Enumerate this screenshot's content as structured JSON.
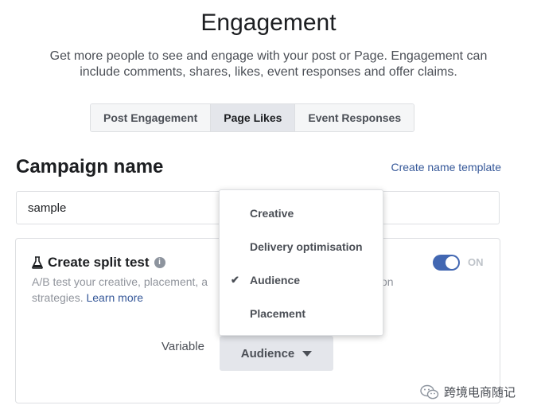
{
  "header": {
    "title": "Engagement",
    "subtitle_line1": "Get more people to see and engage with your post or Page. Engagement can",
    "subtitle_line2": "include comments, shares, likes, event responses and offer claims."
  },
  "tabs": [
    {
      "label": "Post Engagement",
      "active": false
    },
    {
      "label": "Page Likes",
      "active": true
    },
    {
      "label": "Event Responses",
      "active": false
    }
  ],
  "campaign": {
    "label": "Campaign name",
    "name_template_link": "Create name template",
    "name_value": "sample"
  },
  "split_test": {
    "title": "Create split test",
    "desc_line1": "A/B test your creative, placement, a",
    "desc_line1_end": "on",
    "desc_line2": "strategies.",
    "learn_more": "Learn more",
    "toggle_label": "ON",
    "toggle_on": true,
    "variable_label": "Variable",
    "variable_value": "Audience"
  },
  "dropdown": {
    "items": [
      {
        "label": "Creative",
        "checked": false
      },
      {
        "label": "Delivery optimisation",
        "checked": false
      },
      {
        "label": "Audience",
        "checked": true
      },
      {
        "label": "Placement",
        "checked": false
      }
    ],
    "check_glyph": "✔"
  },
  "watermark": {
    "text": "跨境电商随记",
    "icon": "wechat-icon"
  },
  "colors": {
    "accent": "#4267b2",
    "link": "#365899",
    "muted_text": "#90949c"
  }
}
